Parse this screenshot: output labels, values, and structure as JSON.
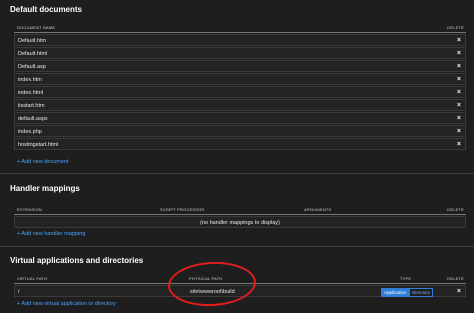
{
  "default_documents": {
    "title": "Default documents",
    "col_name": "DOCUMENT NAME",
    "col_delete": "DELETE",
    "rows": [
      "Default.htm",
      "Default.html",
      "Default.asp",
      "index.htm",
      "index.html",
      "iisstart.htm",
      "default.aspx",
      "index.php",
      "hostingstart.html"
    ],
    "add_label": "+ Add new document"
  },
  "handler_mappings": {
    "title": "Handler mappings",
    "col_extension": "EXTENSION",
    "col_script": "SCRIPT PROCESSOR",
    "col_arguments": "ARGUMENTS",
    "col_delete": "DELETE",
    "empty_text": "(no handler mappings to display)",
    "add_label": "+ Add new handler mapping"
  },
  "virtual_apps": {
    "title": "Virtual applications and directories",
    "col_virtual": "VIRTUAL PATH",
    "col_physical": "PHYSICAL PATH",
    "col_type": "TYPE",
    "col_delete": "DELETE",
    "row": {
      "virtual_path": "/",
      "physical_path": "site\\wwwroot\\build",
      "type_application": "Application",
      "type_directory": "Directory"
    },
    "add_label": "+ Add new virtual application or directory"
  },
  "icons": {
    "delete": "×"
  },
  "colors": {
    "link": "#4aa3ff",
    "highlight_circle": "#e21d1d",
    "badge_selected": "#2f7fd8"
  }
}
